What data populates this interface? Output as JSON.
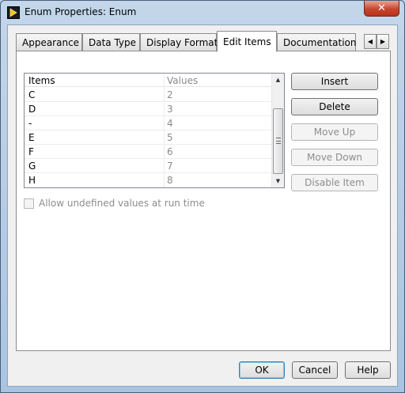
{
  "window": {
    "title": "Enum Properties: Enum",
    "close_label": "✕"
  },
  "tabs": [
    {
      "label": "Appearance",
      "active": false
    },
    {
      "label": "Data Type",
      "active": false
    },
    {
      "label": "Display Format",
      "active": false
    },
    {
      "label": "Edit Items",
      "active": true
    },
    {
      "label": "Documentation",
      "active": false
    }
  ],
  "tab_scroll": {
    "left": "◀",
    "right": "▶"
  },
  "list": {
    "headers": {
      "items": "Items",
      "values": "Values"
    },
    "rows": [
      {
        "item": "C",
        "value": "2"
      },
      {
        "item": "D",
        "value": "3"
      },
      {
        "item": "-",
        "value": "4"
      },
      {
        "item": "E",
        "value": "5"
      },
      {
        "item": "F",
        "value": "6"
      },
      {
        "item": "G",
        "value": "7"
      },
      {
        "item": "H",
        "value": "8"
      }
    ],
    "scroll_up": "▲",
    "scroll_down": "▼"
  },
  "buttons": {
    "insert": "Insert",
    "delete": "Delete",
    "move_up": "Move Up",
    "move_down": "Move Down",
    "disable_item": "Disable Item"
  },
  "checkbox": {
    "label": "Allow undefined values at run time",
    "checked": false
  },
  "footer": {
    "ok": "OK",
    "cancel": "Cancel",
    "help": "Help"
  }
}
